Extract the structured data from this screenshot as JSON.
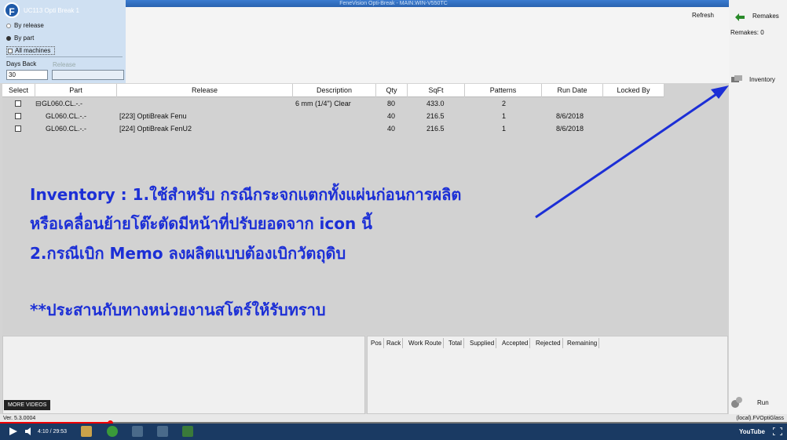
{
  "window": {
    "caption": "FeneVision Opti-Break - MAIN.WIN-V550TC",
    "app_title": "UC113 Opti Break 1",
    "app_icon_letter": "F"
  },
  "filters": {
    "by_release": "By release",
    "by_part": "By part",
    "all_machines": "All machines",
    "days_back_label": "Days Back",
    "days_back_value": "30",
    "release_label": "Release",
    "release_value": ""
  },
  "toolbar": {
    "refresh": "Refresh",
    "remakes": "Remakes",
    "remakes_count": "Remakes: 0",
    "inventory": "Inventory",
    "run": "Run"
  },
  "grid": {
    "columns": [
      "Select",
      "Part",
      "Release",
      "Description",
      "Qty",
      "SqFt",
      "Patterns",
      "Run Date",
      "Locked By"
    ],
    "rows": [
      {
        "part": "GL060.CL.-.-",
        "release": "",
        "description": "6 mm (1/4\") Clear",
        "qty": "80",
        "sqft": "433.0",
        "patterns": "2",
        "run_date": "",
        "locked_by": "",
        "expander": "⊟"
      },
      {
        "part": "GL060.CL.-.-",
        "release": "[223] OptiBreak Fenu",
        "description": "",
        "qty": "40",
        "sqft": "216.5",
        "patterns": "1",
        "run_date": "8/6/2018",
        "locked_by": "",
        "expander": ""
      },
      {
        "part": "GL060.CL.-.-",
        "release": "[224] OptiBreak FenU2",
        "description": "",
        "qty": "40",
        "sqft": "216.5",
        "patterns": "1",
        "run_date": "8/6/2018",
        "locked_by": "",
        "expander": ""
      }
    ]
  },
  "annotation": {
    "line1": "Inventory : 1.ใช้สำหรับ กรณีกระจกแตกทั้งแผ่นก่อนการผลิต",
    "line2": "หรือเคลื่อนย้ายโต๊ะตัดมีหน้าที่ปรับยอดจาก icon นี้",
    "line3": "2.กรณีเบิก Memo ลงผลิตแบบต้องเบิกวัตถุดิบ",
    "line4": "**ประสานกับทางหน่วยงานสโตร์ให้รับทราบ",
    "color": "#1c2fd6"
  },
  "lower_grid": {
    "columns": [
      "Pos",
      "Rack",
      "Work Route",
      "Total",
      "Supplied",
      "Accepted",
      "Rejected",
      "Remaining"
    ]
  },
  "status": {
    "version": "Ver. 5.3.0004",
    "server": "(local).FVOptiGlass"
  },
  "player": {
    "more_videos": "MORE VIDEOS",
    "time": "4:10 / 29:53",
    "youtube": "YouTube",
    "progress_fraction": 0.14
  }
}
